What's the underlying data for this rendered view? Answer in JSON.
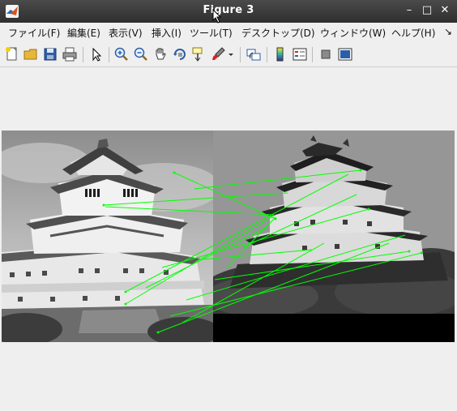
{
  "window": {
    "title": "Figure 3",
    "controls": [
      "–",
      "□",
      "✕"
    ]
  },
  "menu": {
    "items": [
      "ファイル(F)",
      "編集(E)",
      "表示(V)",
      "挿入(I)",
      "ツール(T)",
      "デスクトップ(D)",
      "ウィンドウ(W)",
      "ヘルプ(H)"
    ],
    "overflow_glyph": "↘"
  },
  "toolbar": {
    "icons": [
      "new-figure-icon",
      "open-file-icon",
      "save-icon",
      "print-icon",
      "edit-plot-arrow-icon",
      "zoom-in-icon",
      "zoom-out-icon",
      "pan-hand-icon",
      "rotate-3d-icon",
      "data-cursor-icon",
      "brush-icon",
      "link-plot-icon",
      "colorbar-icon",
      "legend-icon",
      "hide-plot-tools-icon",
      "show-plot-tools-icon"
    ],
    "match_line_color": "#00ff00"
  },
  "figure": {
    "left_image": "grayscale-castle-left",
    "right_image": "grayscale-castle-right"
  }
}
